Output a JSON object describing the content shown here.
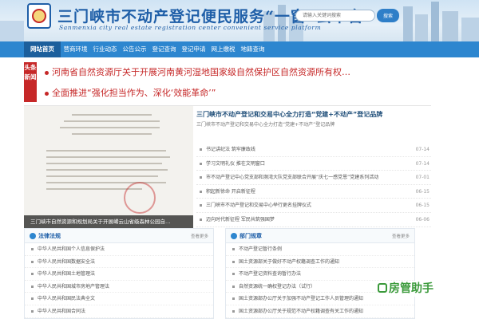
{
  "header": {
    "title": "三门峡市不动产登记便民服务“一窗”云平台",
    "subtitle": "Sanmenxia city real estate registration center convenient service platform",
    "search": {
      "placeholder": "请输入关键词搜索",
      "button_label": "搜索"
    }
  },
  "nav": {
    "items": [
      {
        "label": "网站首页",
        "active": true
      },
      {
        "label": "营商环境",
        "active": false
      },
      {
        "label": "行业动态",
        "active": false
      },
      {
        "label": "公告公示",
        "active": false
      },
      {
        "label": "登记查询",
        "active": false
      },
      {
        "label": "登记申请",
        "active": false
      },
      {
        "label": "网上缴税",
        "active": false
      },
      {
        "label": "地籍查询",
        "active": false
      }
    ]
  },
  "headlines": {
    "tag": "头条新闻",
    "items": [
      "河南省自然资源厅关于开展河南黄河湿地国家级自然保护区自然资源所有权…",
      "全面推进“强化担当作为、深化‘效能革命’”"
    ]
  },
  "feature": {
    "photo_caption": "三门峡市自然资源和规划局关于开展崤云山省级森林公园自…",
    "title": "三门峡市不动产登记和交易中心全力打造“党建+不动产”登记品牌",
    "subtitle": "三门峡市不动产登记和交易中心全力打造“党建+不动产”登记品牌",
    "news": [
      {
        "title": "书记讲纪法 筑牢廉政线",
        "date": "07-14"
      },
      {
        "title": "学习文明礼仪 推在文明窗口",
        "date": "07-14"
      },
      {
        "title": "市不动产登记中心党支部和濒湾大队党支部联合开展“庆七一感党恩”党建系列活动",
        "date": "07-01"
      },
      {
        "title": "积起新徐命 开启新征程",
        "date": "06-15"
      },
      {
        "title": "三门峡市不动产登记和交易中心举行更名挂牌仪式",
        "date": "06-15"
      },
      {
        "title": "迈向时代新征程 军民共筑强国梦",
        "date": "06-06"
      }
    ]
  },
  "laws": {
    "title": "法律法规",
    "more": "查看更多",
    "items": [
      "中华人民共和国个人信息保护法",
      "中华人民共和国数据安全法",
      "中华人民共和国土地管理法",
      "中华人民共和国城市房地产管理法",
      "中华人民共和国民法典全文",
      "中华人民共和国合同法"
    ]
  },
  "rules": {
    "title": "部门规章",
    "more": "查看更多",
    "items": [
      "不动产登记暂行条例",
      "国土资源部关于做好不动产权籍调查工作的通知",
      "不动产登记资料查询暂行办法",
      "自然资源统一确权登记办法（试行）",
      "国土资源部办公厅关于加强不动产登记工作人员管理的通知",
      "国土资源部办公厅关于规范不动产权籍调查有关工作的通知"
    ]
  },
  "watermark": "房管助手",
  "colors": {
    "brand_blue": "#2d86cf",
    "nav_active": "#1c5f9c",
    "headline_red": "#c62828"
  }
}
